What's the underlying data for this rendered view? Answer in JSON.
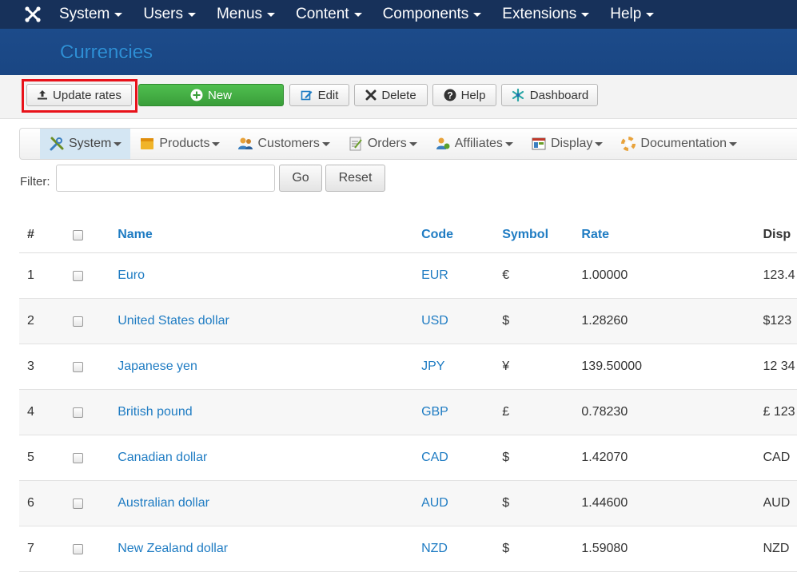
{
  "topnav": {
    "logo": "joomla-logo",
    "items": [
      "System",
      "Users",
      "Menus",
      "Content",
      "Components",
      "Extensions",
      "Help"
    ]
  },
  "header": {
    "title": "Currencies"
  },
  "toolbar": {
    "update_rates": "Update rates",
    "new": "New",
    "edit": "Edit",
    "delete": "Delete",
    "help": "Help",
    "dashboard": "Dashboard"
  },
  "submenu": {
    "items": [
      "System",
      "Products",
      "Customers",
      "Orders",
      "Affiliates",
      "Display",
      "Documentation"
    ]
  },
  "filter": {
    "label": "Filter:",
    "value": "",
    "go": "Go",
    "reset": "Reset"
  },
  "table": {
    "headers": {
      "num": "#",
      "name": "Name",
      "code": "Code",
      "symbol": "Symbol",
      "rate": "Rate",
      "display": "Disp"
    },
    "rows": [
      {
        "num": "1",
        "name": "Euro",
        "code": "EUR",
        "symbol": "€",
        "rate": "1.00000",
        "display": "123.4"
      },
      {
        "num": "2",
        "name": "United States dollar",
        "code": "USD",
        "symbol": "$",
        "rate": "1.28260",
        "display": "$123"
      },
      {
        "num": "3",
        "name": "Japanese yen",
        "code": "JPY",
        "symbol": "¥",
        "rate": "139.50000",
        "display": "12 34"
      },
      {
        "num": "4",
        "name": "British pound",
        "code": "GBP",
        "symbol": "£",
        "rate": "0.78230",
        "display": "£ 123"
      },
      {
        "num": "5",
        "name": "Canadian dollar",
        "code": "CAD",
        "symbol": "$",
        "rate": "1.42070",
        "display": "CAD"
      },
      {
        "num": "6",
        "name": "Australian dollar",
        "code": "AUD",
        "symbol": "$",
        "rate": "1.44600",
        "display": "AUD"
      },
      {
        "num": "7",
        "name": "New Zealand dollar",
        "code": "NZD",
        "symbol": "$",
        "rate": "1.59080",
        "display": "NZD"
      }
    ]
  },
  "colors": {
    "topnav": "#17315a",
    "header": "#1c4b8a",
    "title": "#2e8fd6",
    "link": "#1f7cc3",
    "highlight": "#e8121a",
    "new_button": "#4fbf4f"
  }
}
